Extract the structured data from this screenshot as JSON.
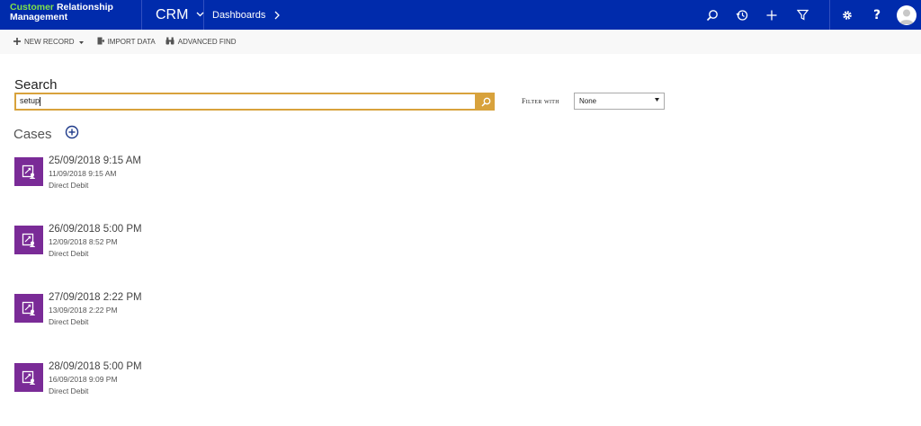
{
  "app": {
    "brand_line1_a": "Customer ",
    "brand_line1_b": "Relationship",
    "brand_line2": "Management",
    "module": "CRM",
    "breadcrumb": "Dashboards"
  },
  "topbar_icons": [
    "search-icon",
    "history-icon",
    "plus-icon",
    "filter-icon",
    "gear-icon",
    "help-icon",
    "user-avatar"
  ],
  "commands": {
    "new_record": "NEW RECORD",
    "import_data": "IMPORT DATA",
    "advanced_find": "ADVANCED FIND"
  },
  "search": {
    "title": "Search",
    "value": "setup"
  },
  "filter": {
    "label": "Filter with",
    "selected": "None"
  },
  "cases": {
    "title": "Cases",
    "records": [
      {
        "line1": "25/09/2018 9:15 AM",
        "line2": "11/09/2018 9:15 AM",
        "line3": "Direct Debit"
      },
      {
        "line1": "26/09/2018 5:00 PM",
        "line2": "12/09/2018 8:52 PM",
        "line3": "Direct Debit"
      },
      {
        "line1": "27/09/2018 2:22 PM",
        "line2": "13/09/2018 2:22 PM",
        "line3": "Direct Debit"
      },
      {
        "line1": "28/09/2018 5:00 PM",
        "line2": "16/09/2018 9:09 PM",
        "line3": "Direct Debit"
      }
    ]
  },
  "colors": {
    "topbar": "#002bac",
    "brand_accent": "#7ee04a",
    "search_accent": "#d8a23c",
    "case_tile": "#7a2b97"
  }
}
